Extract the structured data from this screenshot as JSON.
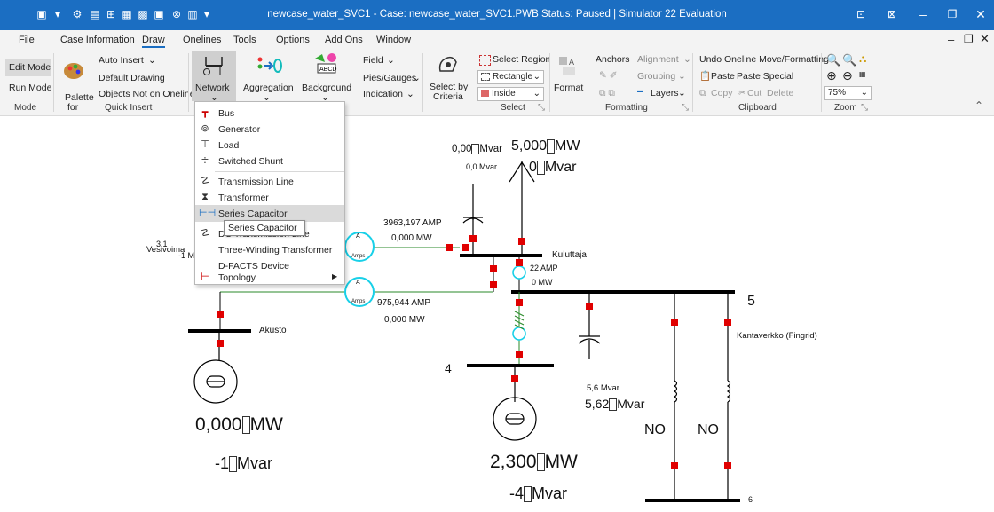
{
  "titlebar": {
    "title": "newcase_water_SVC1 - Case: newcase_water_SVC1.PWB  Status: Paused | Simulator 22 Evaluation",
    "color": "#1b6ec2"
  },
  "menu": [
    "File",
    "Case Information",
    "Draw",
    "Onelines",
    "Tools",
    "Options",
    "Add Ons",
    "Window"
  ],
  "ribbon": {
    "mode": {
      "edit": "Edit Mode",
      "run": "Run Mode",
      "group": "Mode"
    },
    "quick_insert": {
      "palette": "Palette",
      "palette_for": "for",
      "auto_insert": "Auto Insert",
      "default_drawing": "Default Drawing",
      "objects_not": "Objects Not on Oneline",
      "group": "Quick Insert"
    },
    "network": "Network",
    "aggregation": "Aggregation",
    "background": "Background",
    "field": "Field",
    "pies": "Pies/Gauges",
    "indication": "Indication",
    "select_by": "Select by",
    "criteria": "Criteria",
    "select_region": "Select Region",
    "rectangle": "Rectangle",
    "inside": "Inside",
    "select_group": "Select",
    "format": "Format",
    "anchors": "Anchors",
    "alignment": "Alignment",
    "grouping": "Grouping",
    "layers": "Layers",
    "formatting_group": "Formatting",
    "undo": "Undo Oneline Move/Formatting",
    "paste": "Paste",
    "paste_special": "Paste Special",
    "copy": "Copy",
    "cut": "Cut",
    "delete": "Delete",
    "clipboard_group": "Clipboard",
    "zoom_value": "75%",
    "zoom_group": "Zoom"
  },
  "dropdown": {
    "items": [
      {
        "label": "Bus",
        "icon": "bus-icon"
      },
      {
        "label": "Generator",
        "icon": "generator-icon"
      },
      {
        "label": "Load",
        "icon": "load-icon"
      },
      {
        "label": "Switched Shunt",
        "icon": "shunt-icon"
      },
      {
        "label": "Transmission Line",
        "icon": "transmission-line-icon"
      },
      {
        "label": "Transformer",
        "icon": "transformer-icon"
      },
      {
        "label": "Series Capacitor",
        "icon": "series-capacitor-icon"
      },
      {
        "label": "DC Transmission Line",
        "icon": "dc-line-icon"
      },
      {
        "label": "Three-Winding Transformer",
        "icon": ""
      },
      {
        "label": "D-FACTS Device",
        "icon": ""
      },
      {
        "label": "Topology",
        "icon": "topology-icon"
      }
    ],
    "tooltip": "Series Capacitor"
  },
  "diagram": {
    "top_load": {
      "mvar_small_label": "0,00",
      "mvar_small_unit": "Mvar",
      "mvar_sub": "0,0 Mvar",
      "mw": "5,000",
      "mw_unit": "MW",
      "mvar": "0",
      "mvar_unit": "Mvar"
    },
    "line1": {
      "amp": "3963,197 AMP",
      "mw": "0,000 MW"
    },
    "line2": {
      "amp": "975,944 AMP",
      "mw": "0,000 MW"
    },
    "meter": "A",
    "meter_amps": "Amps",
    "vesivoima": {
      "name": "Vesivoima",
      "a": "3,1",
      "b": "-1 M"
    },
    "kuluttaja": "Kuluttaja",
    "akusto": "Akusto",
    "small_line": {
      "amp": "22 AMP",
      "mw": "0 MW"
    },
    "bus5": "5",
    "kantaverkko": "Kantaverkko (Fingrid)",
    "bus4": "4",
    "bus6": "6",
    "shunt": {
      "mvar_sub": "5,6 Mvar",
      "mvar": "5,62",
      "unit": "Mvar"
    },
    "gen_left": {
      "mw": "0,000",
      "mw_unit": "MW",
      "mvar": "-1",
      "mvar_unit": "Mvar"
    },
    "gen_mid": {
      "mw": "2,300",
      "mw_unit": "MW",
      "mvar": "-4",
      "mvar_unit": "Mvar"
    },
    "no1": "NO",
    "no2": "NO"
  }
}
